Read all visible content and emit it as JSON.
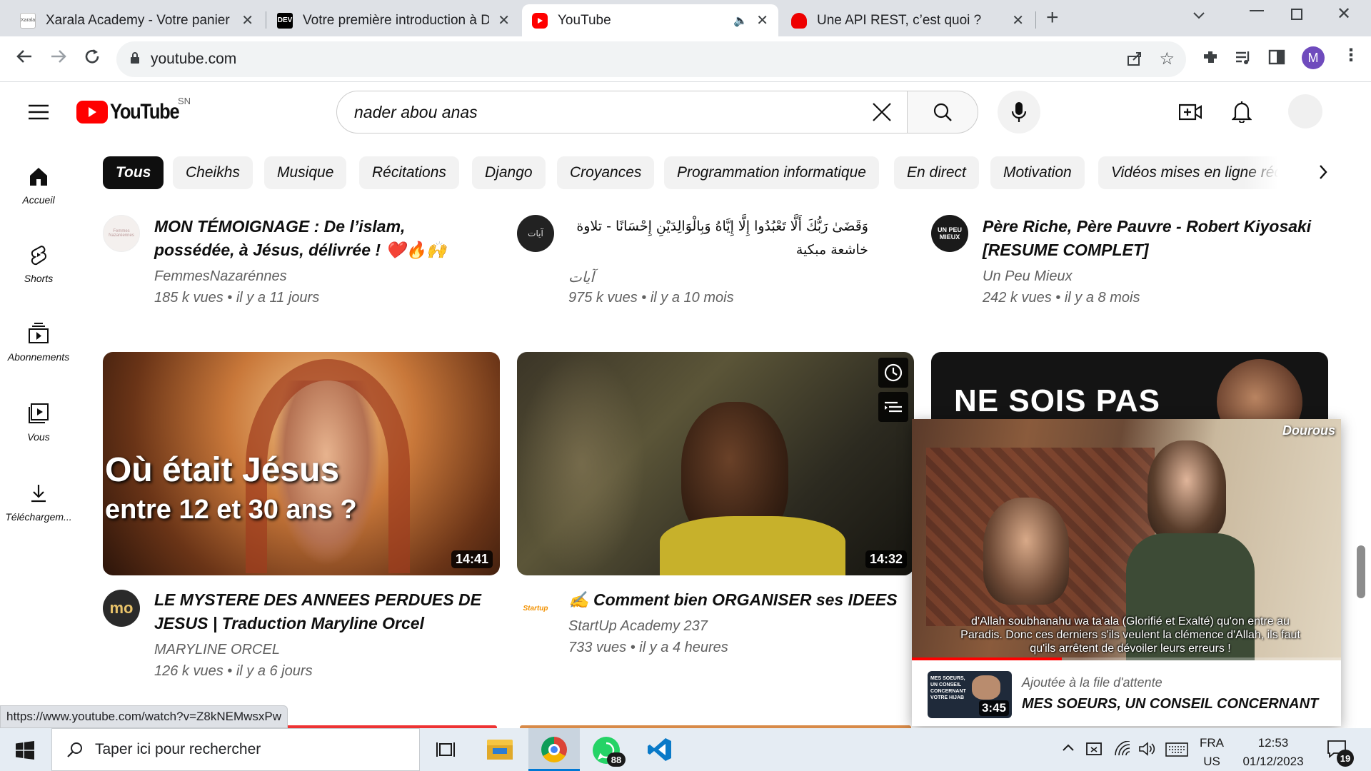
{
  "browser": {
    "tabs": [
      {
        "title": "Xarala Academy - Votre panier",
        "favicon": "xarala-icon"
      },
      {
        "title": "Votre première introduction à Dj",
        "favicon": "dev-icon"
      },
      {
        "title": "YouTube",
        "favicon": "youtube-icon"
      },
      {
        "title": "Une API REST, c’est quoi ?",
        "favicon": "redhat-icon"
      }
    ],
    "url": "youtube.com",
    "profile_initial": "M",
    "status_url": "https://www.youtube.com/watch?v=Z8kNEMwsxPw"
  },
  "youtube": {
    "logo_text": "YouTube",
    "country": "SN",
    "search_value": "nader abou anas",
    "chips": [
      "Tous",
      "Cheikhs",
      "Musique",
      "Récitations",
      "Django",
      "Croyances",
      "Programmation informatique",
      "En direct",
      "Motivation",
      "Vidéos mises en ligne réc"
    ],
    "nav": [
      "Accueil",
      "Shorts",
      "Abonnements",
      "Vous",
      "Téléchargem..."
    ],
    "row1": [
      {
        "title": "MON TÉMOIGNAGE : De l’islam, possédée, à Jésus, délivrée ! ❤️🔥🙌",
        "channel": "FemmesNazarénnes",
        "views": "185 k vues",
        "age": "il y a 11 jours",
        "avatar_text": "Femmes Nazaréennes"
      },
      {
        "title": "وَقَضَىٰ رَبُّكَ أَلَّا تَعْبُدُوا إِلَّا إِيَّاهُ وَبِالْوَالِدَيْنِ إِحْسَانًا - تلاوة خاشعة مبكية",
        "channel": "آيات",
        "views": "975 k vues",
        "age": "il y a 10 mois",
        "avatar_text": "آيات"
      },
      {
        "title": "Père Riche, Père Pauvre - Robert Kiyosaki [RESUME COMPLET]",
        "channel": "Un Peu Mieux",
        "views": "242 k vues",
        "age": "il y a 8 mois",
        "avatar_text": "UN PEU MIEUX"
      }
    ],
    "row2": [
      {
        "title": "LE MYSTERE DES ANNEES PERDUES DE JESUS | Traduction Maryline Orcel",
        "channel": "MARYLINE ORCEL",
        "views": "126 k vues",
        "age": "il y a 6 jours",
        "duration": "14:41",
        "thumb_line1": "Où était Jésus",
        "thumb_line2": "entre 12 et 30 ans ?",
        "avatar_text": "mo"
      },
      {
        "title": "✍️ Comment bien ORGANISER ses IDEES",
        "channel": "StartUp Academy 237",
        "views": "733 vues",
        "age": "il y a 4 heures",
        "duration": "14:32",
        "avatar_text": "Startup"
      },
      {
        "thumb_text": "NE SOIS PAS"
      }
    ],
    "miniplayer": {
      "watermark": "Dourous",
      "subtitle": "d'Allah soubhanahu wa ta'ala (Glorifié et Exalté) qu'on entre au Paradis. Donc ces derniers s'ils veulent la clémence d'Allah, ils faut qu'ils arrêtent de dévoiler leurs erreurs !",
      "progress": 0.35,
      "queue_label": "Ajoutée à la file d'attente",
      "queue_title": "MES SOEURS, UN CONSEIL CONCERNANT",
      "queue_duration": "3:45",
      "queue_thumb_text": "MES SOEURS, UN CONSEIL CONCERNANT VOTRE HIJAB"
    }
  },
  "taskbar": {
    "search_placeholder": "Taper ici pour rechercher",
    "whatsapp_badge": "88",
    "lang": "FRA",
    "region": "US",
    "time": "12:53",
    "date": "01/12/2023",
    "notif_count": "19"
  }
}
